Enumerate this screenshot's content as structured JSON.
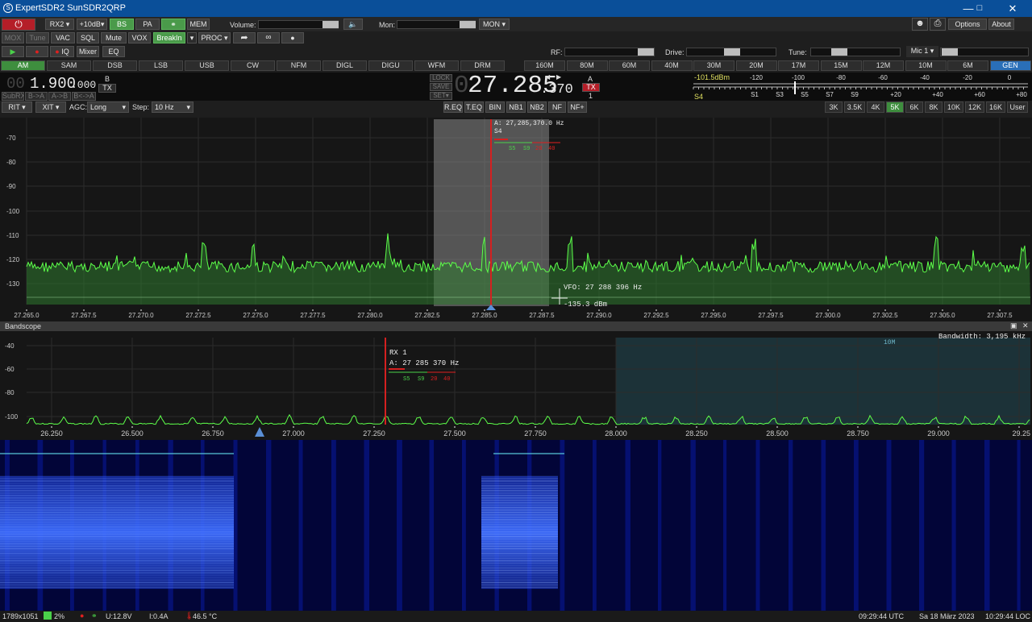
{
  "window": {
    "title": "ExpertSDR2 SunSDR2QRP",
    "icon": "app-logo-icon"
  },
  "toolbar1": {
    "rx2": "RX2",
    "gain": "+10dB",
    "bs": "BS",
    "pa": "PA",
    "mem": "MEM",
    "volume_label": "Volume:",
    "mon_label": "Mon:",
    "mon_btn": "MON",
    "options": "Options",
    "about": "About"
  },
  "toolbar2": {
    "mox": "MOX",
    "tune": "Tune",
    "vac": "VAC",
    "sql": "SQL",
    "mute": "Mute",
    "vox": "VOX",
    "breakin": "BreakIn",
    "proc": "PROC"
  },
  "toolbar3": {
    "iq": "IQ",
    "mixer": "Mixer",
    "eq": "EQ",
    "rf_label": "RF:",
    "drive_label": "Drive:",
    "tune_label": "Tune:",
    "mic": "Mic 1"
  },
  "modes": [
    "AM",
    "SAM",
    "DSB",
    "LSB",
    "USB",
    "CW",
    "NFM",
    "DIGL",
    "DIGU",
    "WFM",
    "DRM"
  ],
  "active_mode": "AM",
  "bands": [
    "160M",
    "80M",
    "60M",
    "40M",
    "30M",
    "20M",
    "17M",
    "15M",
    "12M",
    "10M",
    "6M",
    "GEN"
  ],
  "active_band": "GEN",
  "vfo_b": {
    "freq_dim": "00",
    "freq_main": "1.900",
    "freq_sub": ".000",
    "label": "B",
    "tx": "TX",
    "subrx": "SubRX",
    "b_to_a": "B->A",
    "a_to_b": "A->B",
    "swap": "B<->A"
  },
  "vfo_a": {
    "lock": "LOCK",
    "save": "SAVE",
    "set": "SET",
    "freq_dim": "0",
    "freq_main": "27.285",
    "freq_sub": ".370",
    "label": "A",
    "tx": "TX",
    "rx": "1"
  },
  "smeter": {
    "dbm": "-101.5dBm",
    "s_value": "S4",
    "top_scale": [
      "-120",
      "-100",
      "-80",
      "-60",
      "-40",
      "-20",
      "0"
    ],
    "bottom_scale": [
      "S1",
      "S3",
      "S5",
      "S7",
      "S9",
      "+20",
      "+40",
      "+60",
      "+80"
    ]
  },
  "toolbar4": {
    "rit": "RIT",
    "xit": "XIT",
    "agc_label": "AGC:",
    "agc_value": "Long",
    "step_label": "Step:",
    "step_value": "10 Hz",
    "req": "R.EQ",
    "teq": "T.EQ",
    "bin": "BIN",
    "nb1": "NB1",
    "nb2": "NB2",
    "nf": "NF",
    "nfplus": "NF+"
  },
  "filters": [
    "3K",
    "3.5K",
    "4K",
    "5K",
    "6K",
    "8K",
    "10K",
    "12K",
    "16K",
    "User"
  ],
  "active_filter": "5K",
  "spectrum": {
    "db_labels": [
      "-70",
      "-80",
      "-90",
      "-100",
      "-110",
      "-120",
      "-130"
    ],
    "freq_labels": [
      "27.265.0",
      "27.267.5",
      "27.270.0",
      "27.272.5",
      "27.275.0",
      "27.277.5",
      "27.280.0",
      "27.282.5",
      "27.285.0",
      "27.287.5",
      "27.290.0",
      "27.292.5",
      "27.295.0",
      "27.297.5",
      "27.300.0",
      "27.302.5",
      "27.305.0",
      "27.307.5"
    ],
    "marker_freq": "A: 27,285,370.0 Hz",
    "marker_s": "S4",
    "marker_scale": [
      "S5",
      "S9",
      "20",
      "40"
    ],
    "cursor_vfo": "VFO: 27 288 396 Hz",
    "cursor_dbm": "-135.3 dBm"
  },
  "bandscope": {
    "title": "Bandscope",
    "bandwidth": "Bandwidth: 3,195 kHz",
    "band_label": "10M",
    "db_labels": [
      "-40",
      "-60",
      "-80",
      "-100"
    ],
    "freq_labels": [
      "26.250",
      "26.500",
      "26.750",
      "27.000",
      "27.250",
      "27.500",
      "27.750",
      "28.000",
      "28.250",
      "28.500",
      "28.750",
      "29.000",
      "29.25"
    ],
    "rx_label": "RX 1",
    "marker_freq": "A: 27 285 370 Hz",
    "marker_scale": [
      "S5",
      "S9",
      "20",
      "40"
    ]
  },
  "status": {
    "resolution": "1789x1051",
    "cpu": "2%",
    "voltage": "U:12.8V",
    "current": "I:0.4A",
    "temp": "46.5 °C",
    "utc": "09:29:44 UTC",
    "date": "Sa 18 März 2023",
    "loc": "10:29:44 LOC"
  },
  "colors": {
    "accent_green": "#3e8e3e",
    "accent_blue": "#2a6fb8",
    "marker_red": "#d42020",
    "trace_green": "#5dff4a",
    "titlebar": "#0a4f99"
  }
}
